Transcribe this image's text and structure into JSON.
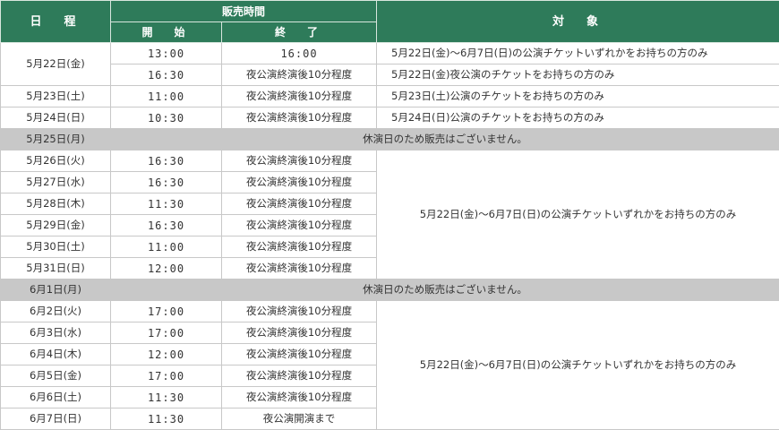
{
  "header": {
    "date": "日　程",
    "sale_time": "販売時間",
    "start": "開　始",
    "end": "終　了",
    "target": "対　象"
  },
  "rows": [
    {
      "date": "5月22日(金)",
      "start": "13:00",
      "end": "16:00",
      "target": "5月22日(金)～6月7日(日)の公演チケットいずれかをお持ちの方のみ"
    },
    {
      "start": "16:30",
      "end": "夜公演終演後10分程度",
      "target": "5月22日(金)夜公演のチケットをお持ちの方のみ"
    },
    {
      "date": "5月23日(土)",
      "start": "11:00",
      "end": "夜公演終演後10分程度",
      "target": "5月23日(土)公演のチケットをお持ちの方のみ"
    },
    {
      "date": "5月24日(日)",
      "start": "10:30",
      "end": "夜公演終演後10分程度",
      "target": "5月24日(日)公演のチケットをお持ちの方のみ"
    },
    {
      "date": "5月25日(月)",
      "closed": "休演日のため販売はございません。"
    },
    {
      "date": "5月26日(火)",
      "start": "16:30",
      "end": "夜公演終演後10分程度",
      "target": "5月22日(金)～6月7日(日)の公演チケットいずれかをお持ちの方のみ"
    },
    {
      "date": "5月27日(水)",
      "start": "16:30",
      "end": "夜公演終演後10分程度"
    },
    {
      "date": "5月28日(木)",
      "start": "11:30",
      "end": "夜公演終演後10分程度"
    },
    {
      "date": "5月29日(金)",
      "start": "16:30",
      "end": "夜公演終演後10分程度"
    },
    {
      "date": "5月30日(土)",
      "start": "11:00",
      "end": "夜公演終演後10分程度"
    },
    {
      "date": "5月31日(日)",
      "start": "12:00",
      "end": "夜公演終演後10分程度"
    },
    {
      "date": "6月1日(月)",
      "closed": "休演日のため販売はございません。"
    },
    {
      "date": "6月2日(火)",
      "start": "17:00",
      "end": "夜公演終演後10分程度",
      "target": "5月22日(金)～6月7日(日)の公演チケットいずれかをお持ちの方のみ"
    },
    {
      "date": "6月3日(水)",
      "start": "17:00",
      "end": "夜公演終演後10分程度"
    },
    {
      "date": "6月4日(木)",
      "start": "12:00",
      "end": "夜公演終演後10分程度"
    },
    {
      "date": "6月5日(金)",
      "start": "17:00",
      "end": "夜公演終演後10分程度"
    },
    {
      "date": "6月6日(土)",
      "start": "11:30",
      "end": "夜公演終演後10分程度"
    },
    {
      "date": "6月7日(日)",
      "start": "11:30",
      "end": "夜公演開演まで"
    }
  ]
}
